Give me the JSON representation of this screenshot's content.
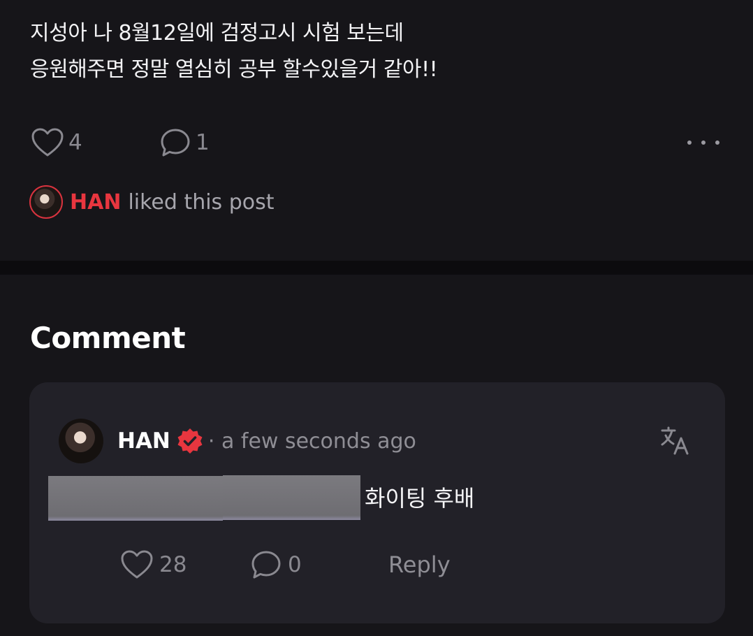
{
  "post": {
    "text_line1": "지성아 나 8월12일에 검정고시 시험 보는데",
    "text_line2": "응원해주면 정말 열심히 공부 할수있을거 같아!!",
    "like_count": "4",
    "comment_count": "1",
    "liked_by": {
      "name": "HAN",
      "text": "liked this post"
    }
  },
  "comments": {
    "title": "Comment",
    "items": [
      {
        "author": "HAN",
        "time": "· a few seconds ago",
        "text": "화이팅 후배",
        "like_count": "28",
        "reply_count": "0",
        "reply_label": "Reply"
      }
    ]
  },
  "colors": {
    "background": "#121114",
    "card": "#222128",
    "accent_red": "#e8363f",
    "muted": "#8a8990"
  },
  "icons": [
    "heart-icon",
    "comment-bubble-icon",
    "more-dots-icon",
    "verified-badge-icon",
    "translate-icon"
  ]
}
